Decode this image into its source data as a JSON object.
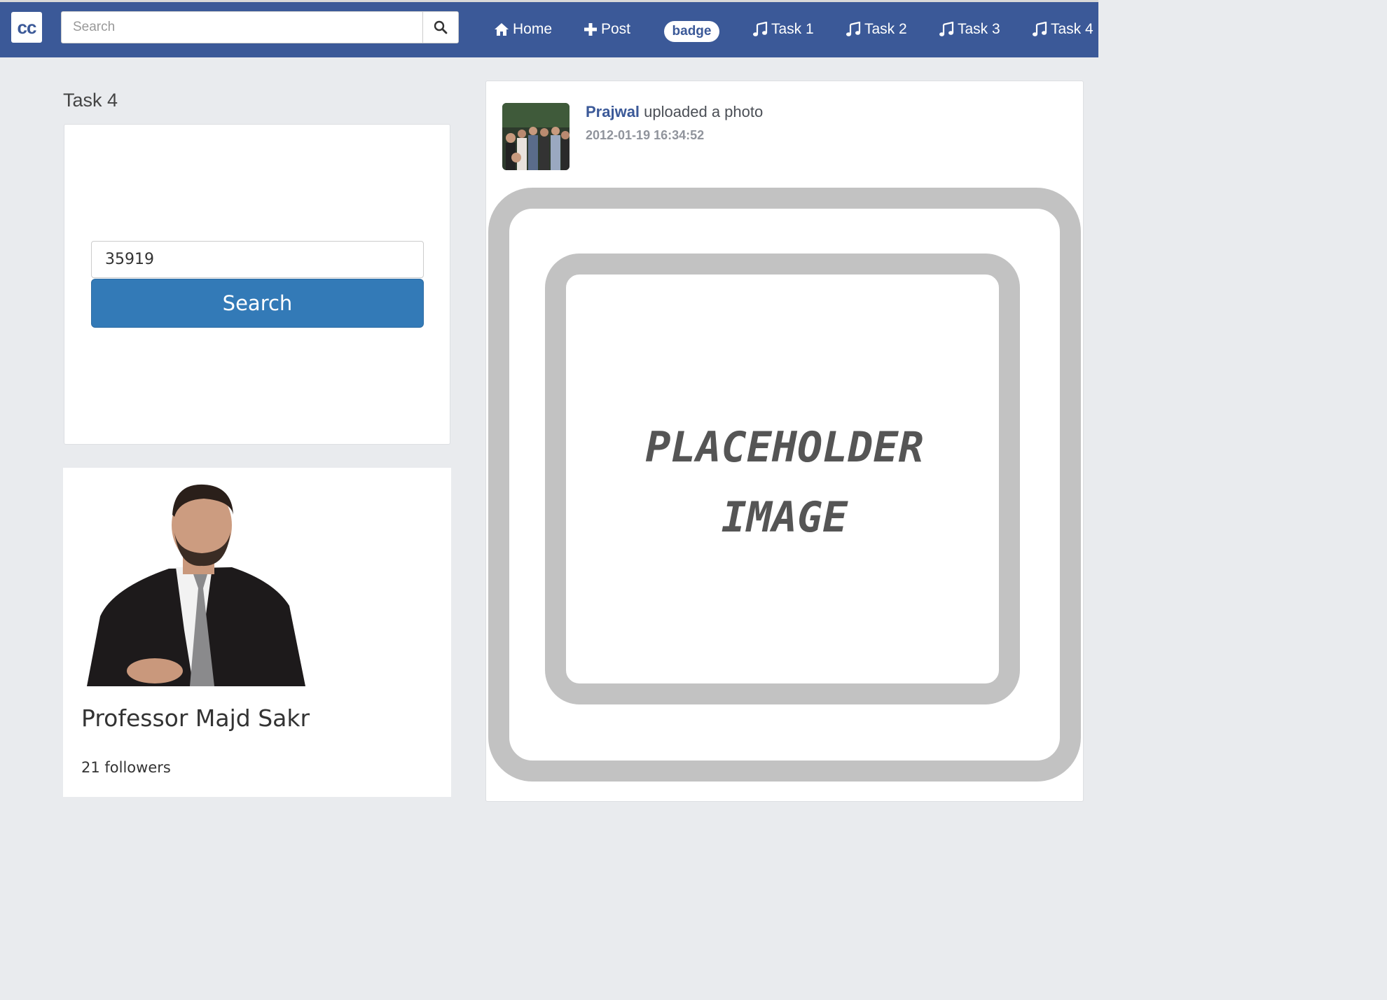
{
  "navbar": {
    "logo_text": "cc",
    "search_placeholder": "Search",
    "home_label": "Home",
    "post_label": "Post",
    "badge_label": "badge",
    "task1_label": "Task 1",
    "task2_label": "Task 2",
    "task3_label": "Task 3",
    "task4_label": "Task 4",
    "color": "#3b5998"
  },
  "left": {
    "title": "Task 4",
    "id_input_value": "35919",
    "search_button_label": "Search",
    "button_color": "#337ab7"
  },
  "profile": {
    "name": "Professor Majd Sakr",
    "followers": "21 followers"
  },
  "feed": {
    "user": "Prajwal",
    "action": "uploaded a photo",
    "timestamp": "2012-01-19 16:34:52",
    "placeholder_line1": "PLACEHOLDER",
    "placeholder_line2": "IMAGE"
  }
}
